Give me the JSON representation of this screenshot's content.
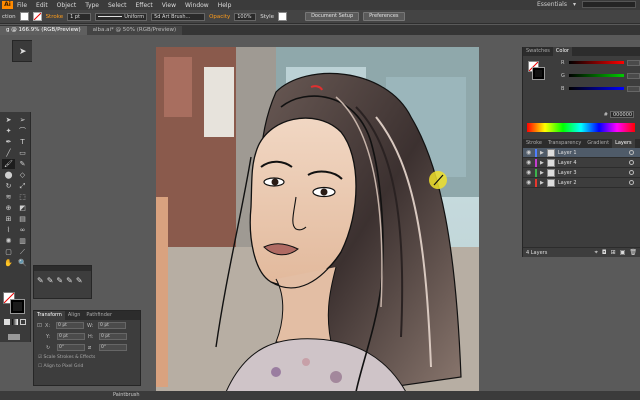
{
  "menubar": {
    "app_icon": "Ai",
    "items": [
      "File",
      "Edit",
      "Object",
      "Type",
      "Select",
      "Effect",
      "View",
      "Window",
      "Help"
    ],
    "workspace": "Essentials"
  },
  "control": {
    "left_label": "ction",
    "stroke_label": "Stroke",
    "stroke_weight": "1 pt",
    "profile": "Uniform",
    "brush": "5d Art Brush...",
    "opacity_label": "Opacity",
    "opacity": "100%",
    "style_label": "Style",
    "doc_setup": "Document Setup",
    "preferences": "Preferences",
    "colors": {
      "fill": "#ffffff",
      "stroke": "#000000",
      "accent": "#ff9c1a"
    }
  },
  "tabs": [
    {
      "label": "g @ 166.9% (RGB/Preview)",
      "active": true
    },
    {
      "label": "alba.ai* @ 50% (RGB/Preview)",
      "active": false
    }
  ],
  "tools": [
    "selection-tool",
    "direct-selection-tool",
    "magic-wand-tool",
    "lasso-tool",
    "pen-tool",
    "type-tool",
    "line-tool",
    "rectangle-tool",
    "paintbrush-tool",
    "pencil-tool",
    "blob-brush-tool",
    "eraser-tool",
    "rotate-tool",
    "scale-tool",
    "width-tool",
    "free-transform-tool",
    "shape-builder-tool",
    "perspective-tool",
    "mesh-tool",
    "gradient-tool",
    "eyedropper-tool",
    "blend-tool",
    "symbol-sprayer-tool",
    "column-graph-tool",
    "artboard-tool",
    "slice-tool",
    "hand-tool",
    "zoom-tool"
  ],
  "transform_panel": {
    "tabs": [
      "Transform",
      "Align",
      "Pathfinder"
    ],
    "fields": {
      "x": "0 pt",
      "y": "0 pt",
      "w": "0 pt",
      "h": "0 pt",
      "rot": "0°",
      "shear": "0°"
    },
    "labels": {
      "x": "X:",
      "y": "Y:",
      "w": "W:",
      "h": "H:"
    },
    "scale_strokes": "Scale Strokes & Effects",
    "align_pixel": "Align to Pixel Grid"
  },
  "color_panel": {
    "tabs": [
      "Swatches",
      "Color"
    ],
    "channels": [
      {
        "label": "R",
        "value": ""
      },
      {
        "label": "G",
        "value": ""
      },
      {
        "label": "B",
        "value": ""
      }
    ],
    "hex_label": "#",
    "hex": "000000"
  },
  "layers_panel": {
    "tabs": [
      "Stroke",
      "Transparency",
      "Gradient",
      "Layers"
    ],
    "layers": [
      {
        "name": "Layer 1",
        "color": "#4f7fff",
        "selected": true
      },
      {
        "name": "Layer 4",
        "color": "#c43bd0",
        "selected": false
      },
      {
        "name": "Layer 3",
        "color": "#3bb64a",
        "selected": false
      },
      {
        "name": "Layer 2",
        "color": "#e6372d",
        "selected": false
      }
    ],
    "count": "4 Layers"
  },
  "status": {
    "tool": "Paintbrush"
  }
}
